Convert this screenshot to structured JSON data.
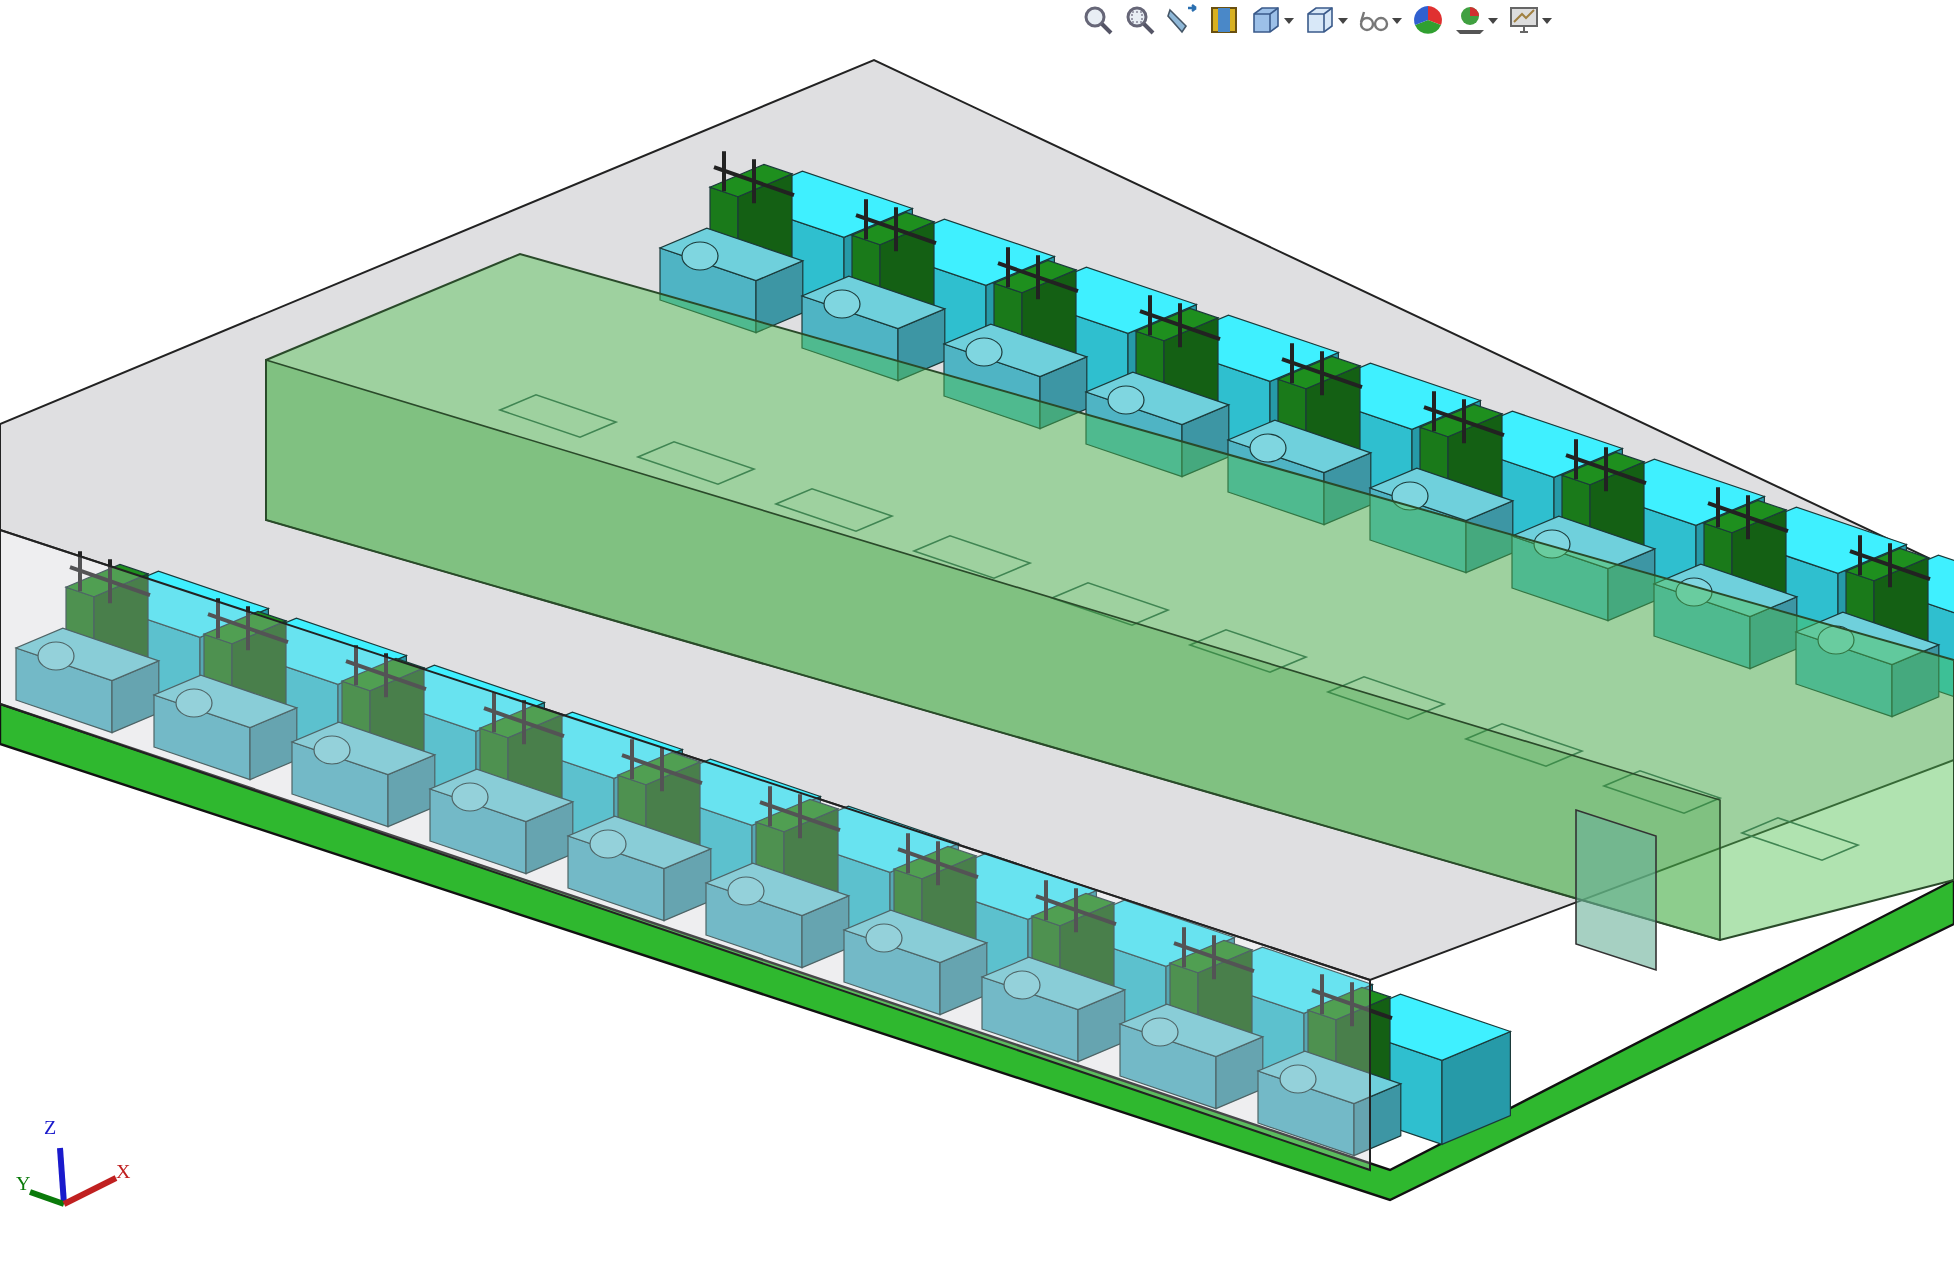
{
  "toolbar": {
    "buttons": [
      {
        "kind": "zoom-fit",
        "dropdown": false
      },
      {
        "kind": "zoom-area",
        "dropdown": false
      },
      {
        "kind": "previous-view",
        "dropdown": false
      },
      {
        "kind": "section-view",
        "dropdown": false
      },
      {
        "kind": "view-orientation",
        "dropdown": true
      },
      {
        "kind": "display-style",
        "dropdown": true
      },
      {
        "kind": "hide-show",
        "dropdown": true
      },
      {
        "kind": "appearance",
        "dropdown": false
      },
      {
        "kind": "scene",
        "dropdown": true
      },
      {
        "kind": "view-settings",
        "dropdown": true
      }
    ]
  },
  "triad": {
    "axes": [
      {
        "label": "Z",
        "color": "#1a1acc"
      },
      {
        "label": "Y",
        "color": "#0a7a0a"
      },
      {
        "label": "X",
        "color": "#c02020"
      }
    ]
  }
}
